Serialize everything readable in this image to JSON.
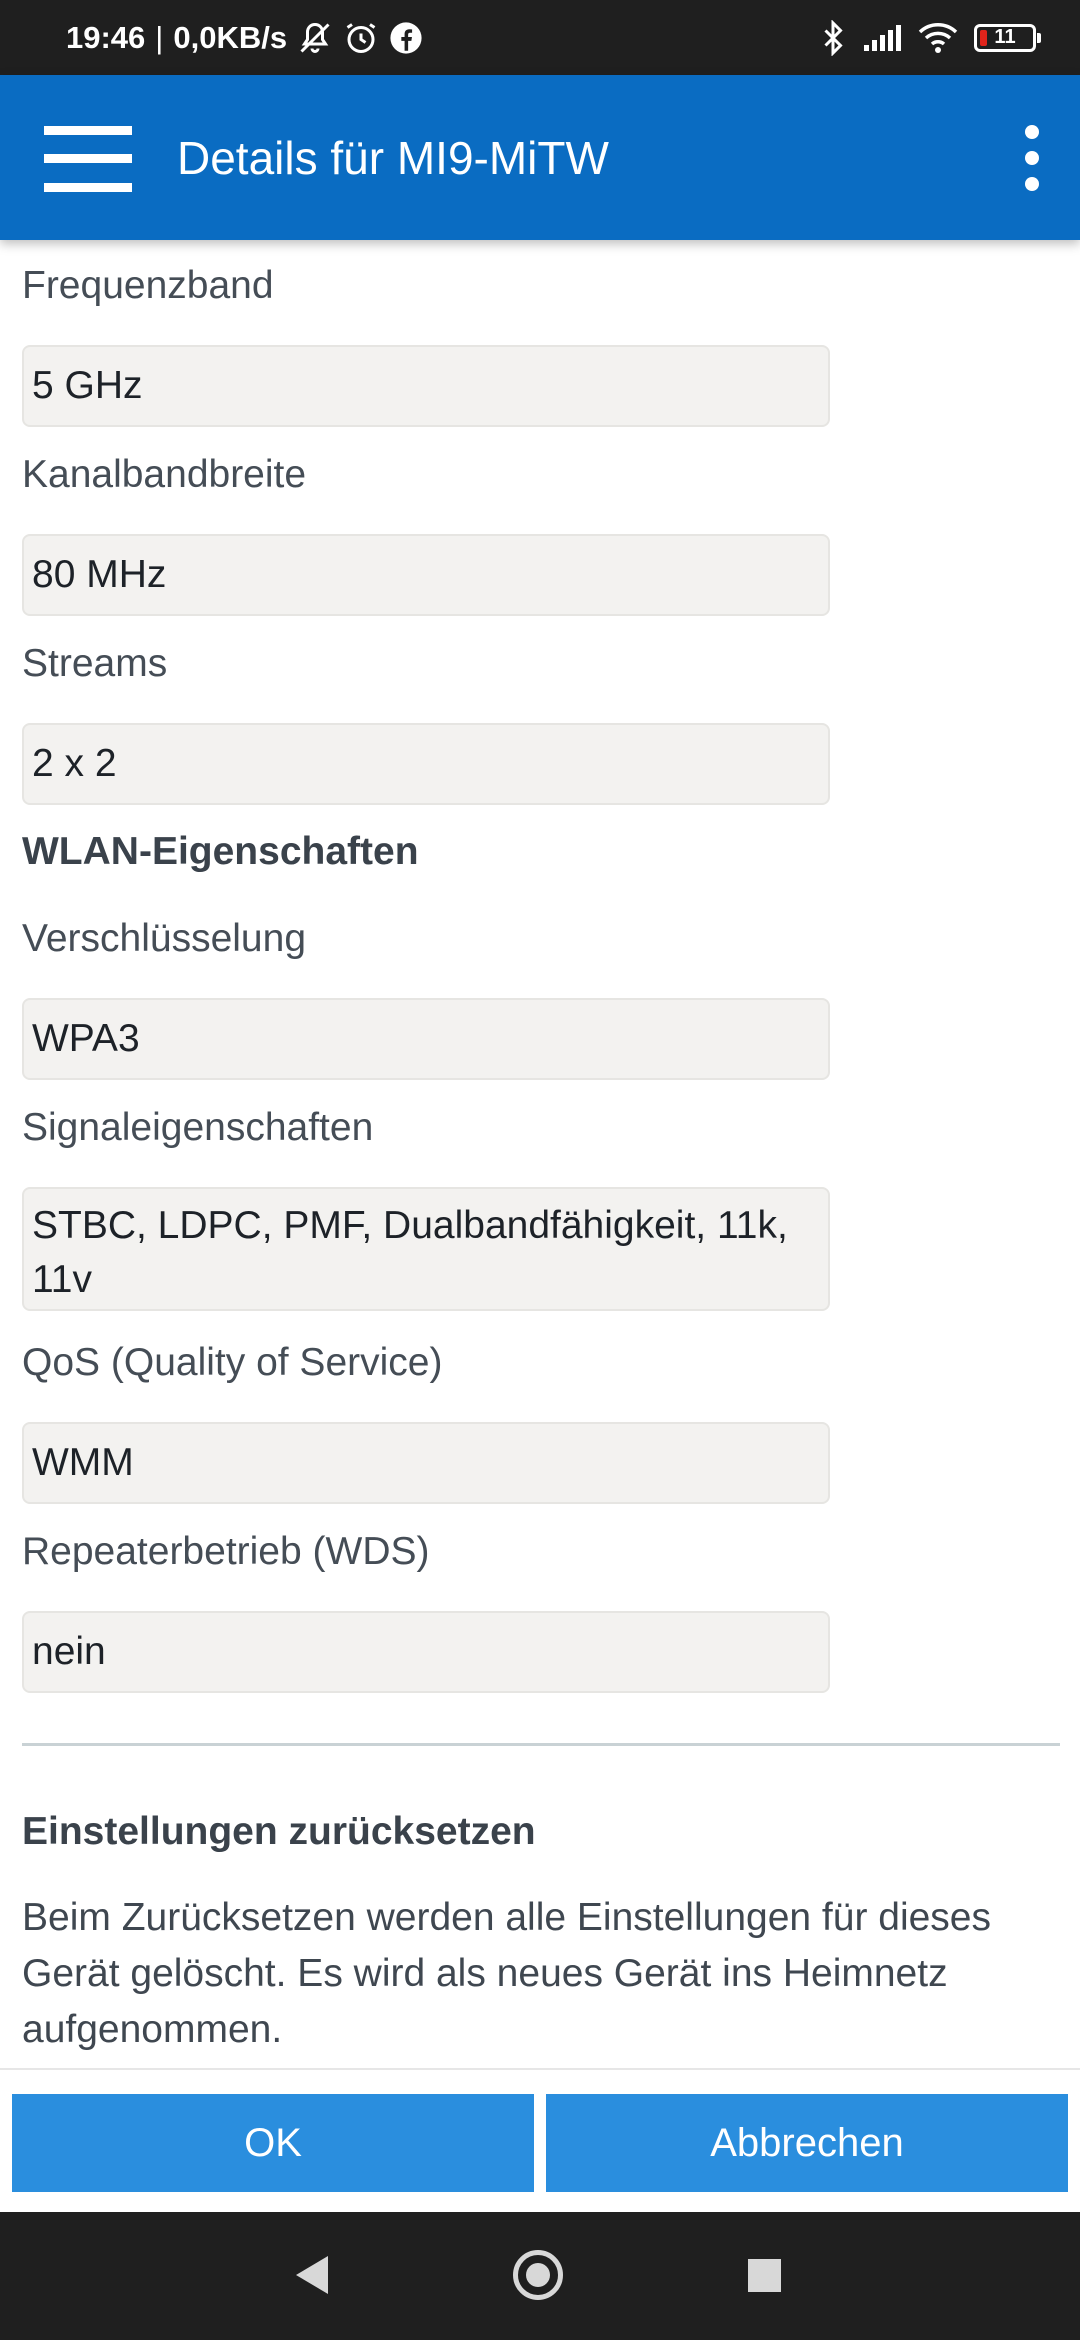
{
  "status_bar": {
    "time": "19:46",
    "separator": "|",
    "network_speed": "0,0KB/s",
    "icons": [
      "notifications-off-icon",
      "alarm-icon",
      "facebook-icon",
      "bluetooth-icon",
      "signal-icon",
      "wifi-icon"
    ],
    "battery_level": "11"
  },
  "app_bar": {
    "title": "Details für MI9-MiTW",
    "menu_icon": "hamburger-menu-icon",
    "overflow_icon": "more-vert-icon",
    "color": "#0a6cc2"
  },
  "fields": [
    {
      "label": "Frequenzband",
      "value": "5 GHz"
    },
    {
      "label": "Kanalbandbreite",
      "value": "80 MHz"
    },
    {
      "label": "Streams",
      "value": "2 x 2"
    }
  ],
  "wlan_section": {
    "title": "WLAN-Eigenschaften",
    "fields": [
      {
        "label": "Verschlüsselung",
        "value": "WPA3"
      },
      {
        "label": "Signaleigenschaften",
        "value_line1": "STBC, LDPC, PMF, Dualbandfähigkeit, 11k,",
        "value_line2": "11v"
      },
      {
        "label": "QoS (Quality of Service)",
        "value": "WMM"
      },
      {
        "label": "Repeaterbetrieb (WDS)",
        "value": "nein"
      }
    ]
  },
  "reset_section": {
    "title": "Einstellungen zurücksetzen",
    "text_line1": "Beim Zurücksetzen werden alle Einstellungen für dieses",
    "text_line2": "Gerät gelöscht. Es wird als neues Gerät ins Heimnetz",
    "text_line3": "aufgenommen."
  },
  "buttons": {
    "ok": "OK",
    "cancel": "Abbrechen",
    "color": "#2a8ede"
  },
  "nav_bar": {
    "icons": [
      "back-icon",
      "home-icon",
      "recent-apps-icon"
    ]
  }
}
